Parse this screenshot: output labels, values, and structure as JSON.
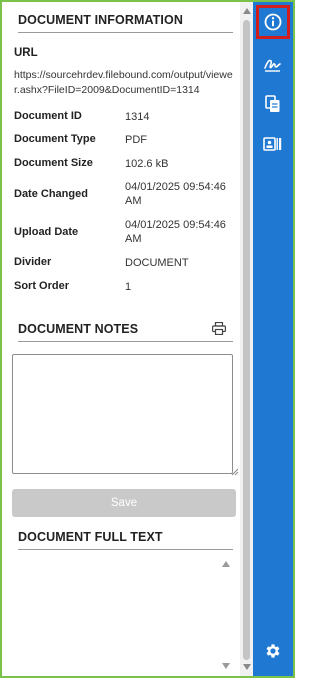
{
  "document_info": {
    "title": "DOCUMENT INFORMATION",
    "url_label": "URL",
    "url_value": "https://sourcehrdev.filebound.com/output/viewer.ashx?FileID=2009&DocumentID=1314",
    "fields": [
      {
        "label": "Document ID",
        "value": "1314"
      },
      {
        "label": "Document Type",
        "value": "PDF"
      },
      {
        "label": "Document Size",
        "value": "102.6 kB"
      },
      {
        "label": "Date Changed",
        "value": "04/01/2025 09:54:46 AM"
      },
      {
        "label": "Upload Date",
        "value": "04/01/2025 09:54:46 AM"
      },
      {
        "label": "Divider",
        "value": "DOCUMENT"
      },
      {
        "label": "Sort Order",
        "value": "1"
      }
    ]
  },
  "document_notes": {
    "title": "DOCUMENT NOTES",
    "print_icon": "printer-icon",
    "notes_value": "",
    "save_label": "Save"
  },
  "document_full_text": {
    "title": "DOCUMENT FULL TEXT",
    "text": ""
  },
  "sidebar": {
    "items": [
      {
        "icon": "info-icon",
        "active": true
      },
      {
        "icon": "signature-icon",
        "active": false
      },
      {
        "icon": "copy-documents-icon",
        "active": false
      },
      {
        "icon": "id-card-barcode-icon",
        "active": false
      },
      {
        "icon": "gear-icon",
        "active": false
      }
    ]
  },
  "colors": {
    "rail": "#1f78d1",
    "active_outline": "#d11d1d",
    "frame_border": "#7bc24a",
    "save_disabled": "#c9c9c9"
  }
}
